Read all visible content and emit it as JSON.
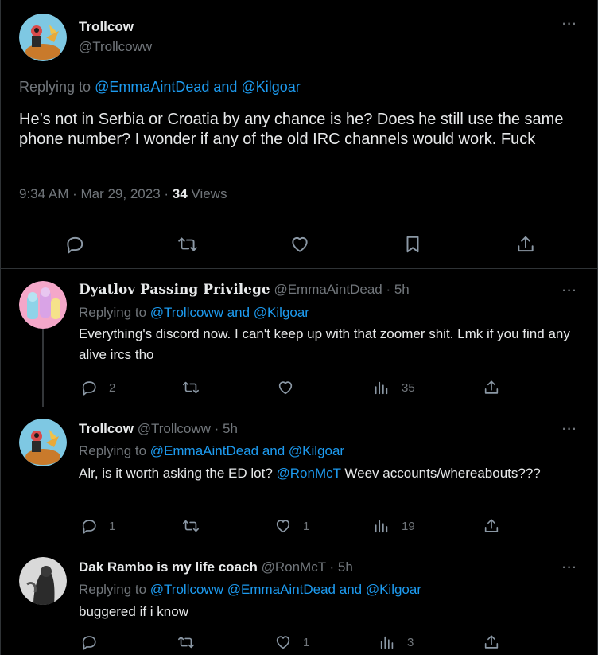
{
  "main_tweet": {
    "author_name": "Trollcow",
    "author_handle": "@Trollcoww",
    "replying_label": "Replying to",
    "replying_to": "@EmmaAintDead and @Kilgoar",
    "text": "He’s not in Serbia or Croatia by any chance is he? Does he still use the same phone number? I wonder if any of the old IRC channels would work. Fuck",
    "time": "9:34 AM · Mar 29, 2023 · ",
    "views_count": "34",
    "views_label": " Views",
    "more": "···"
  },
  "replies": [
    {
      "author_name": "Dyatlov Passing Privilege",
      "author_handle": "@EmmaAintDead · 5h",
      "replying_label": "Replying to",
      "replying_to": "@Trollcoww and @Kilgoar",
      "text": "Everything's discord now. I can't keep up with that zoomer shit. Lmk if you find any alive ircs tho",
      "reply_count": "2",
      "retweet_count": "",
      "like_count": "",
      "view_count": "35",
      "more": "···"
    },
    {
      "author_name": "Trollcow",
      "author_handle": "@Trollcoww · 5h",
      "replying_label": "Replying to",
      "replying_to": "@EmmaAintDead and @Kilgoar",
      "text_before": "Alr, is it worth asking the ED lot? ",
      "text_mention": "@RonMcT",
      "text_after": " Weev accounts/whereabouts???",
      "reply_count": "1",
      "retweet_count": "",
      "like_count": "1",
      "view_count": "19",
      "more": "···"
    },
    {
      "author_name": "Dak Rambo is my life coach",
      "author_handle": "@RonMcT · 5h",
      "replying_label": "Replying to",
      "replying_to": "@Trollcoww @EmmaAintDead and @Kilgoar",
      "text": "buggered if i know",
      "reply_count": "",
      "retweet_count": "",
      "like_count": "1",
      "view_count": "3",
      "more": "···"
    }
  ],
  "icons": {
    "reply": "reply-icon",
    "retweet": "retweet-icon",
    "like": "heart-icon",
    "bookmark": "bookmark-icon",
    "share": "share-icon",
    "views": "views-icon"
  },
  "colors": {
    "background": "#000000",
    "text": "#e7e9ea",
    "muted": "#71767b",
    "link": "#1d9bf0",
    "divider": "#2f3336"
  }
}
